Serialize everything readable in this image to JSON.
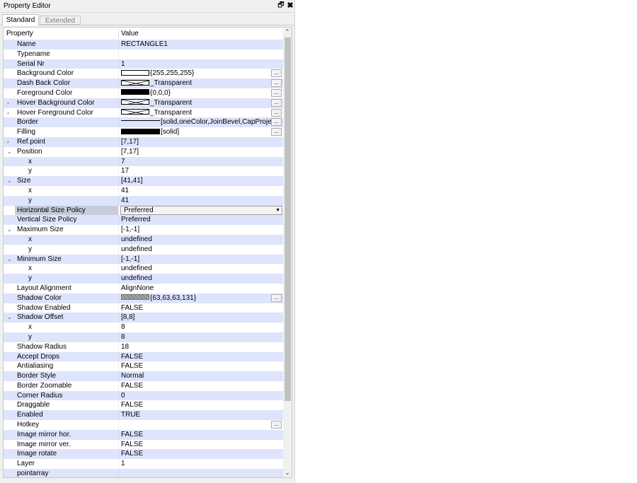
{
  "window": {
    "title": "Property Editor",
    "float_icon": "restore-icon",
    "close_icon": "close-icon",
    "float_glyph": "🗗",
    "close_glyph": "✖"
  },
  "tabs": [
    {
      "label": "Standard",
      "active": true
    },
    {
      "label": "Extended",
      "active": false
    }
  ],
  "table": {
    "headers": {
      "property": "Property",
      "value": "Value"
    },
    "dropdown_glyph": "▼",
    "ellipsis_label": "...",
    "expand_glyph": "›",
    "collapse_glyph": "⌄",
    "rows": [
      {
        "label": "Name",
        "value": "RECTANGLE1",
        "level": 1
      },
      {
        "label": "Typename",
        "value": "",
        "level": 1
      },
      {
        "label": "Serial Nr",
        "value": "1",
        "level": 1
      },
      {
        "label": "Background Color",
        "value": "{255,255,255}",
        "level": 1,
        "swatch": "white",
        "ellipsis": true
      },
      {
        "label": "Dash Back Color",
        "value": "_Transparent",
        "level": 1,
        "swatch": "trans",
        "ellipsis": true
      },
      {
        "label": "Foreground Color",
        "value": "{0,0,0}",
        "level": 1,
        "swatch": "black",
        "ellipsis": true
      },
      {
        "label": "Hover Background Color",
        "value": "_Transparent",
        "level": 1,
        "swatch": "trans",
        "ellipsis": true,
        "expand": "collapsed"
      },
      {
        "label": "Hover Foreground Color",
        "value": "_Transparent",
        "level": 1,
        "swatch": "trans",
        "ellipsis": true,
        "expand": "collapsed"
      },
      {
        "label": "Border",
        "value": "[solid,oneColor,JoinBevel,CapProject]",
        "level": 1,
        "swatch": "line",
        "ellipsis": true
      },
      {
        "label": "Filling",
        "value": "[solid]",
        "level": 1,
        "swatch": "black-wide",
        "ellipsis": true
      },
      {
        "label": "Ref.point",
        "value": "[7,17]",
        "level": 1,
        "expand": "collapsed"
      },
      {
        "label": "Position",
        "value": "[7,17]",
        "level": 1,
        "expand": "expanded"
      },
      {
        "label": "x",
        "value": "7",
        "level": 2
      },
      {
        "label": "y",
        "value": "17",
        "level": 2
      },
      {
        "label": "Size",
        "value": "[41,41]",
        "level": 1,
        "expand": "expanded"
      },
      {
        "label": "x",
        "value": "41",
        "level": 2
      },
      {
        "label": "y",
        "value": "41",
        "level": 2
      },
      {
        "label": "Horizontal Size Policy",
        "value": "Preferred",
        "level": 1,
        "dropdown": true,
        "selected": true
      },
      {
        "label": "Vertical Size Policy",
        "value": "Preferred",
        "level": 1
      },
      {
        "label": "Maximum Size",
        "value": "[-1,-1]",
        "level": 1,
        "expand": "expanded"
      },
      {
        "label": "x",
        "value": "undefined",
        "level": 2
      },
      {
        "label": "y",
        "value": "undefined",
        "level": 2
      },
      {
        "label": "Minimum Size",
        "value": "[-1,-1]",
        "level": 1,
        "expand": "expanded"
      },
      {
        "label": "x",
        "value": "undefined",
        "level": 2
      },
      {
        "label": "y",
        "value": "undefined",
        "level": 2
      },
      {
        "label": "Layout Alignment",
        "value": "AlignNone",
        "level": 1
      },
      {
        "label": "Shadow Color",
        "value": "{63,63,63,131}",
        "level": 1,
        "swatch": "gray",
        "ellipsis": true
      },
      {
        "label": "Shadow Enabled",
        "value": "FALSE",
        "level": 1
      },
      {
        "label": "Shadow Offset",
        "value": "[8,8]",
        "level": 1,
        "expand": "expanded"
      },
      {
        "label": "x",
        "value": "8",
        "level": 2
      },
      {
        "label": "y",
        "value": "8",
        "level": 2
      },
      {
        "label": "Shadow Radius",
        "value": "18",
        "level": 1
      },
      {
        "label": "Accept Drops",
        "value": "FALSE",
        "level": 1
      },
      {
        "label": "Antialiasing",
        "value": "FALSE",
        "level": 1
      },
      {
        "label": "Border Style",
        "value": "Normal",
        "level": 1
      },
      {
        "label": "Border Zoomable",
        "value": "FALSE",
        "level": 1
      },
      {
        "label": "Corner Radius",
        "value": "0",
        "level": 1
      },
      {
        "label": "Draggable",
        "value": "FALSE",
        "level": 1
      },
      {
        "label": "Enabled",
        "value": "TRUE",
        "level": 1
      },
      {
        "label": "Hotkey",
        "value": "",
        "level": 1,
        "ellipsis": true
      },
      {
        "label": "Image mirror hor.",
        "value": "FALSE",
        "level": 1
      },
      {
        "label": "Image mirror ver.",
        "value": "FALSE",
        "level": 1
      },
      {
        "label": "Image rotate",
        "value": "FALSE",
        "level": 1
      },
      {
        "label": "Layer",
        "value": "1",
        "level": 1
      },
      {
        "label": "pointarray",
        "value": "",
        "level": 1
      }
    ]
  },
  "scrollbar": {
    "up_glyph": "⌃",
    "down_glyph": "⌄"
  },
  "colors": {
    "alt_row": "#dde4fc",
    "selected_label": "#c8ccdc"
  }
}
